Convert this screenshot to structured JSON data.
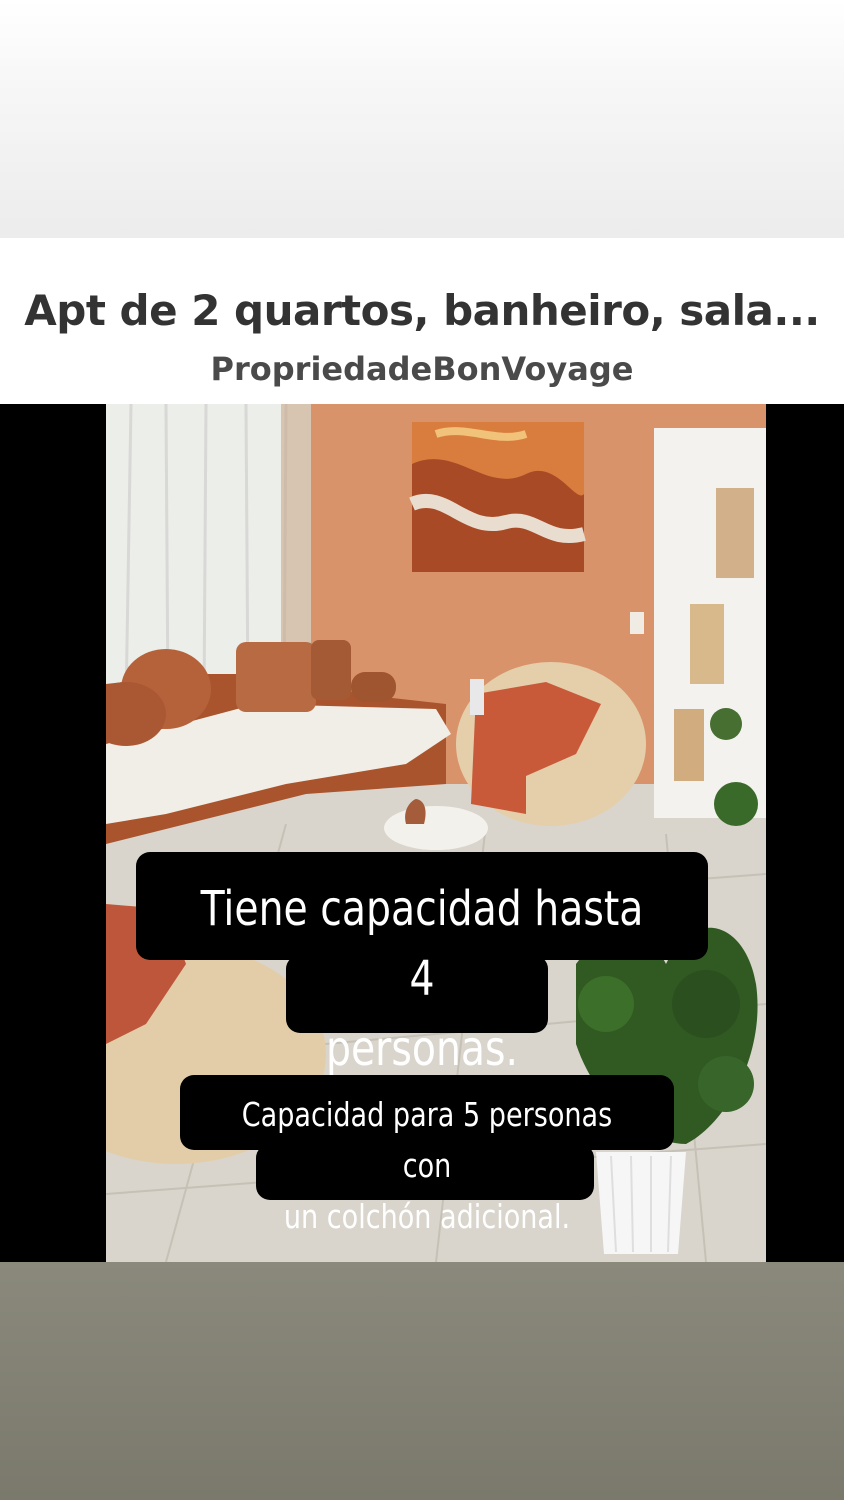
{
  "post": {
    "title": "Apt de 2 quartos, banheiro, sala...",
    "author": "PropriedadeBonVoyage"
  },
  "photo": {
    "overlay_texts": [
      {
        "text": "Tiene capacidad hasta 4\npersonas."
      },
      {
        "text": "Capacidad para 5 personas con\nun colchón adicional."
      }
    ]
  },
  "colors": {
    "wall": "#d9936b",
    "sofa": "#a9542c",
    "throw": "#c85a3a",
    "caption_bg": "#000000",
    "bottom_band": "#807f72"
  }
}
